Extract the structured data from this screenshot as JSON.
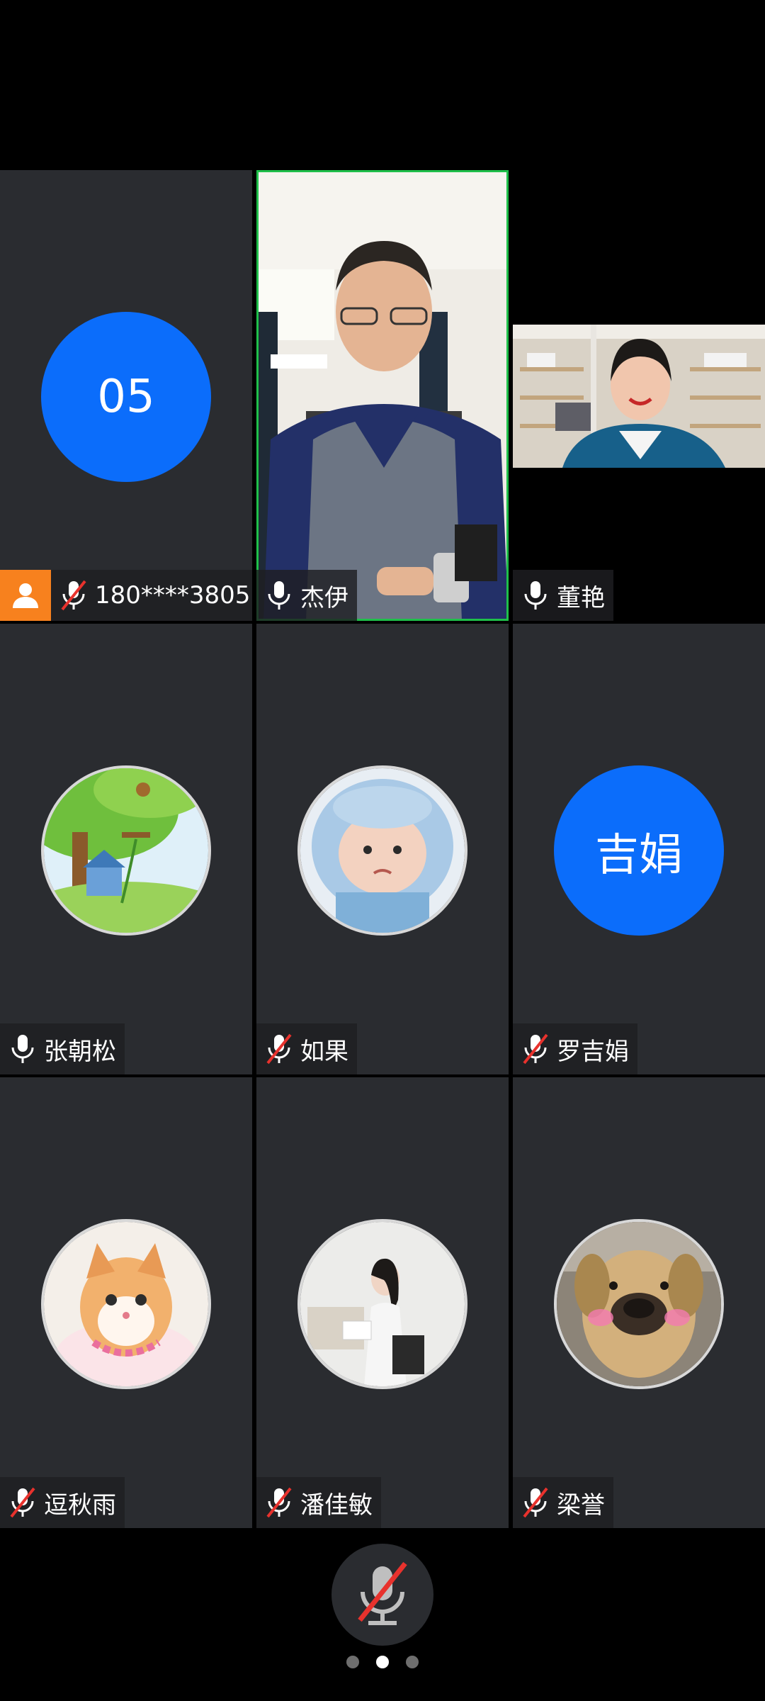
{
  "participants": [
    {
      "name": "180****3805",
      "avatar_text": "05",
      "avatar_type": "initials",
      "mic": "muted",
      "host": true
    },
    {
      "name": "杰伊",
      "avatar_type": "video",
      "mic": "on",
      "active_speaker": true
    },
    {
      "name": "董艳",
      "avatar_type": "video",
      "mic": "on"
    },
    {
      "name": "张朝松",
      "avatar_type": "picture",
      "avatar_icon": "cartoon-treehouse-avatar",
      "mic": "on"
    },
    {
      "name": "如果",
      "avatar_type": "picture",
      "avatar_icon": "baby-avatar",
      "mic": "muted"
    },
    {
      "name": "罗吉娟",
      "avatar_text": "吉娟",
      "avatar_type": "initials",
      "mic": "muted"
    },
    {
      "name": "逗秋雨",
      "avatar_type": "picture",
      "avatar_icon": "kitten-avatar",
      "mic": "muted"
    },
    {
      "name": "潘佳敏",
      "avatar_type": "picture",
      "avatar_icon": "woman-photo-avatar",
      "mic": "muted"
    },
    {
      "name": "梁誉",
      "avatar_type": "picture",
      "avatar_icon": "dog-avatar",
      "mic": "muted"
    }
  ],
  "controls": {
    "mic_button_state": "muted",
    "page_indicator": {
      "pages": 3,
      "current": 2
    }
  },
  "colors": {
    "tile_bg": "#2a2c30",
    "avatar_blue": "#0b6dfb",
    "host_badge": "#f7811e",
    "active_border": "#1fbf4a",
    "mute_slash": "#e8322d"
  }
}
